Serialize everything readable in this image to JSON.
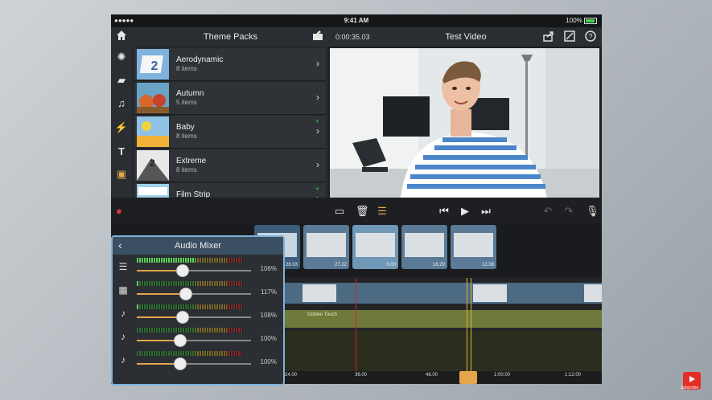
{
  "status": {
    "signal": "●●●●● ",
    "time": "9:41 AM",
    "battery": "100%"
  },
  "theme_panel": {
    "title": "Theme Packs"
  },
  "project": {
    "timecode": "0:00:35.03",
    "title": "Test Video"
  },
  "themes": [
    {
      "name": "Aerodynamic",
      "count": "8 items",
      "new": false
    },
    {
      "name": "Autumn",
      "count": "5 items",
      "new": false
    },
    {
      "name": "Baby",
      "count": "8 items",
      "new": true
    },
    {
      "name": "Extreme",
      "count": "8 items",
      "new": false
    },
    {
      "name": "Film Strip",
      "count": "",
      "new": true
    }
  ],
  "clips": [
    {
      "duration": "26.03"
    },
    {
      "duration": "27.22"
    },
    {
      "duration": "0.00"
    },
    {
      "duration": "18.29"
    },
    {
      "duration": "12.08"
    }
  ],
  "audio_track_label": "Golden Touch",
  "ruler": {
    "ticks": [
      "24.00",
      "36.00",
      "48.00",
      "1:00.00",
      "1:12.00"
    ]
  },
  "mixer": {
    "title": "Audio Mixer",
    "channels": [
      {
        "icon": "adjust-icon",
        "percent": "106%",
        "value": 0.4,
        "meter": 0.55
      },
      {
        "icon": "film-icon",
        "percent": "117%",
        "value": 0.43,
        "meter": 0.02
      },
      {
        "icon": "music-icon",
        "percent": "108%",
        "value": 0.4,
        "meter": 0.02
      },
      {
        "icon": "music-icon",
        "percent": "100%",
        "value": 0.38,
        "meter": 0.0
      },
      {
        "icon": "music-icon",
        "percent": "100%",
        "value": 0.38,
        "meter": 0.0
      }
    ]
  },
  "colors": {
    "accent": "#7fb2d8",
    "record": "#e03b3b",
    "new_plus": "#3fbf4a"
  }
}
